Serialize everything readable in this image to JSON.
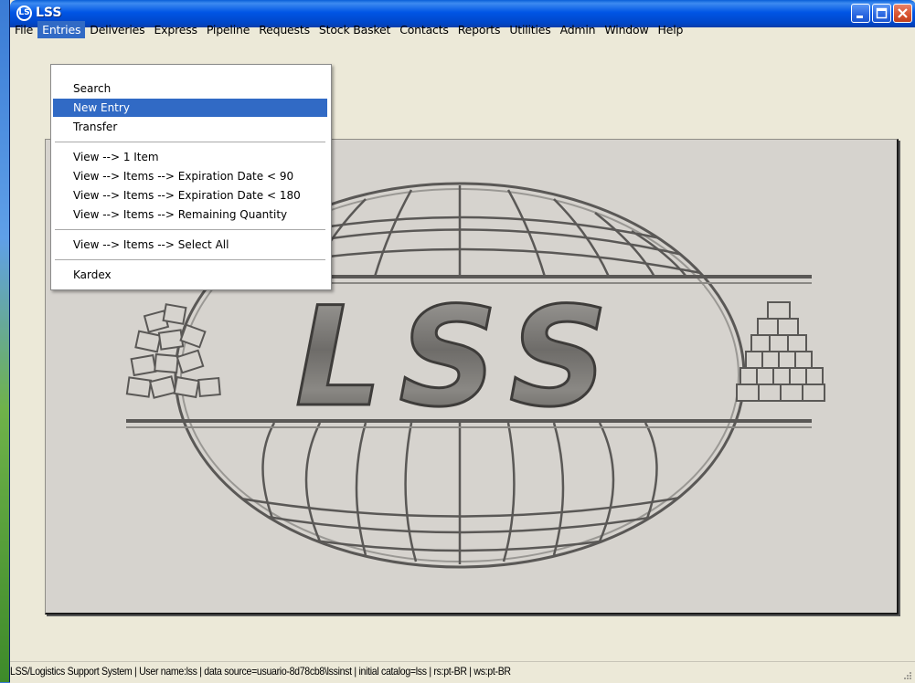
{
  "window": {
    "title": "LSS",
    "app_icon_text": "LS"
  },
  "menubar": {
    "items": [
      "File",
      "Entries",
      "Deliveries",
      "Express",
      "Pipeline",
      "Requests",
      "Stock Basket",
      "Contacts",
      "Reports",
      "Utilities",
      "Admin",
      "Window",
      "Help"
    ],
    "active": "Entries"
  },
  "entries_menu": {
    "search": "Search",
    "new_entry": "New Entry",
    "transfer": "Transfer",
    "view_1_item": "View --> 1 Item",
    "view_exp_90": "View --> Items --> Expiration Date < 90",
    "view_exp_180": "View --> Items --> Expiration Date < 180",
    "view_remaining": "View --> Items --> Remaining Quantity",
    "view_select_all": "View --> Items --> Select All",
    "kardex": "Kardex",
    "highlighted": "New Entry"
  },
  "logo": {
    "text": "LSS"
  },
  "statusbar": {
    "text": "LSS/Logistics Support System | User name:lss | data source=usuario-8d78cb8\\lssinst | initial catalog=lss | rs:pt-BR | ws:pt-BR"
  },
  "colors": {
    "titlebar": "#0055e5",
    "menu_highlight": "#316ac5",
    "window_bg": "#ece9d8",
    "panel_bg": "#d6d3ce"
  }
}
